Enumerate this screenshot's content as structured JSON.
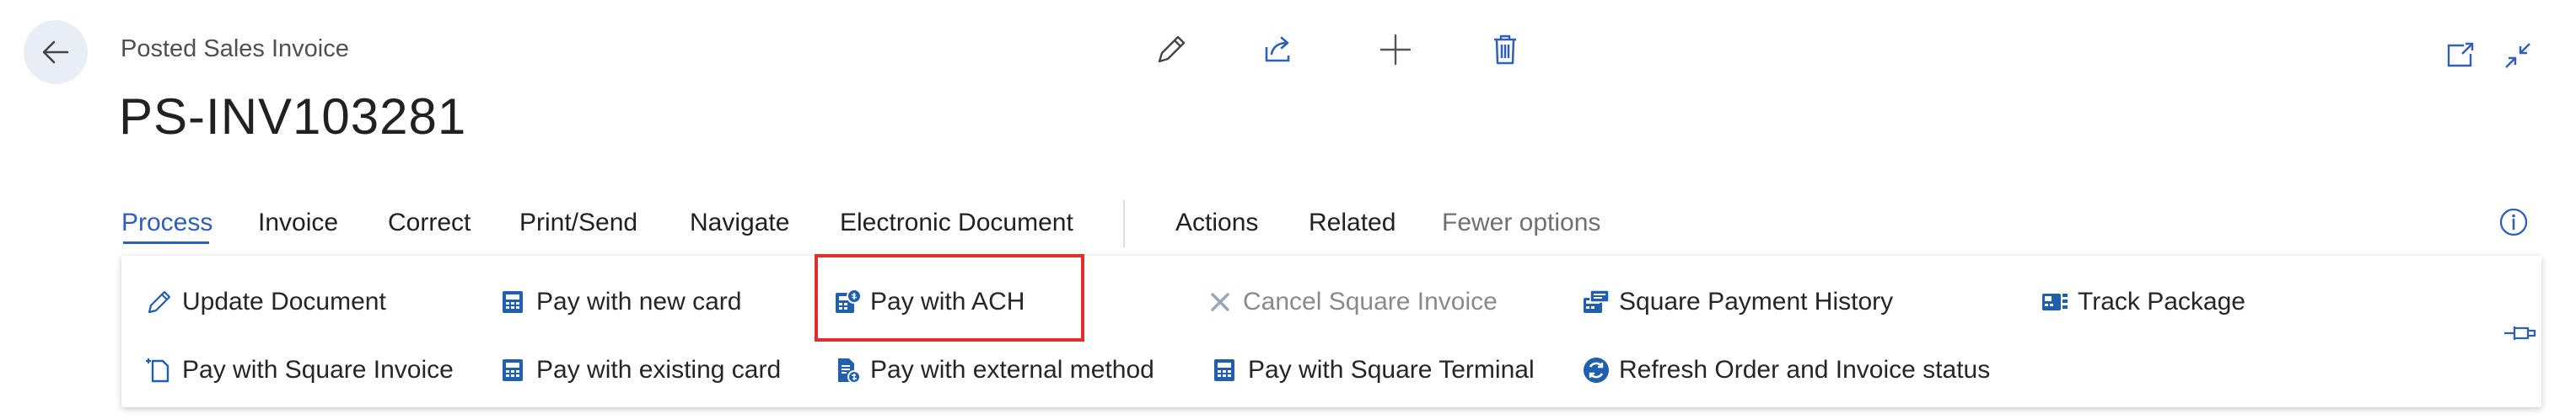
{
  "header": {
    "caption": "Posted Sales Invoice",
    "title": "PS-INV103281"
  },
  "tabs": [
    {
      "label": "Process",
      "active": true
    },
    {
      "label": "Invoice"
    },
    {
      "label": "Correct"
    },
    {
      "label": "Print/Send"
    },
    {
      "label": "Navigate"
    },
    {
      "label": "Electronic Document"
    },
    {
      "label": "Actions"
    },
    {
      "label": "Related"
    },
    {
      "label": "Fewer options",
      "muted": true
    }
  ],
  "ribbon": {
    "row1": [
      {
        "label": "Update Document",
        "icon": "pencil-icon"
      },
      {
        "label": "Pay with new card",
        "icon": "card-terminal-icon"
      },
      {
        "label": "Pay with ACH",
        "icon": "ach-payment-icon",
        "highlighted": true
      },
      {
        "label": "Cancel Square Invoice",
        "icon": "cancel-x-icon",
        "disabled": true
      },
      {
        "label": "Square Payment History",
        "icon": "payment-history-icon"
      },
      {
        "label": "Track Package",
        "icon": "track-package-icon"
      }
    ],
    "row2": [
      {
        "label": "Pay with Square Invoice",
        "icon": "new-document-icon"
      },
      {
        "label": "Pay with existing card",
        "icon": "card-terminal-icon"
      },
      {
        "label": "Pay with external method",
        "icon": "document-payment-icon"
      },
      {
        "label": "Pay with Square Terminal",
        "icon": "card-terminal-icon"
      },
      {
        "label": "Refresh Order and Invoice status",
        "icon": "refresh-icon"
      }
    ]
  },
  "colors": {
    "accent": "#2f60b5",
    "highlight": "#e03131",
    "icon_blue": "#1f5fad"
  }
}
